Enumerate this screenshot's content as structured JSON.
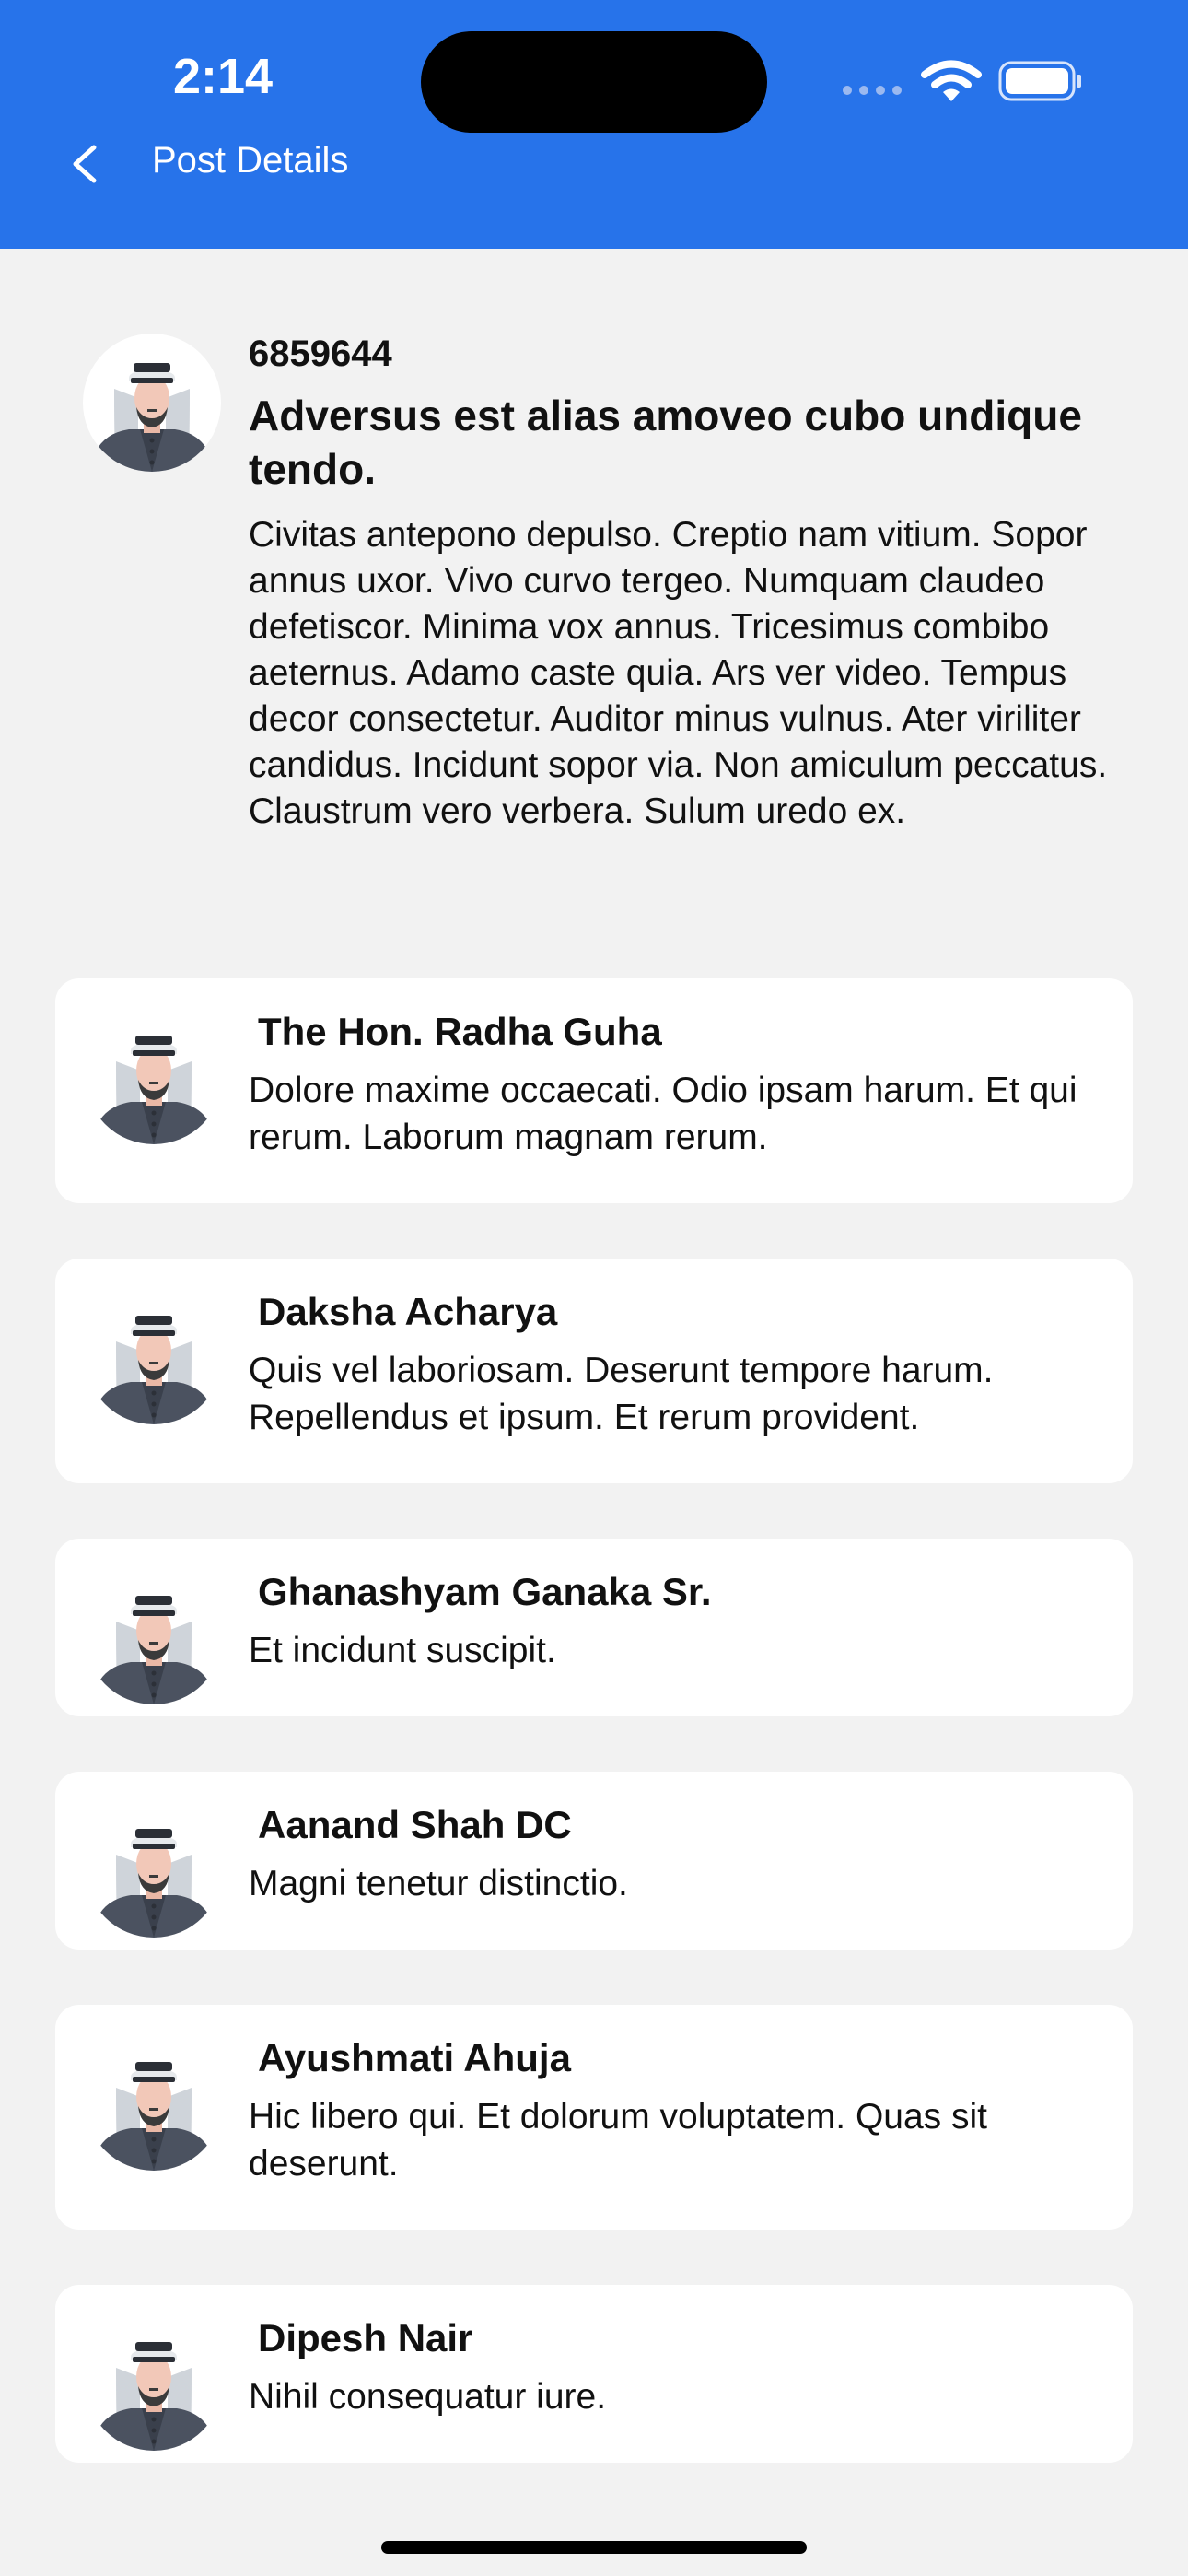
{
  "status_bar": {
    "time": "2:14"
  },
  "nav": {
    "title": "Post Details"
  },
  "colors": {
    "header": "#2773ea",
    "background": "#f2f2f2",
    "card": "#ffffff"
  },
  "post": {
    "id": "6859644",
    "title": "Adversus est alias amoveo cubo undique tendo.",
    "body": "Civitas antepono depulso. Creptio nam vitium. Sopor annus uxor. Vivo curvo tergeo. Numquam claudeo defetiscor. Minima vox annus. Tricesimus combibo aeternus. Adamo caste quia. Ars ver video. Tempus decor consectetur. Auditor minus vulnus. Ater viriliter candidus. Incidunt sopor via. Non amiculum peccatus. Claustrum vero verbera. Sulum uredo ex."
  },
  "comments": [
    {
      "name": "The Hon. Radha Guha",
      "text": "Dolore maxime occaecati. Odio ipsam harum. Et qui rerum. Laborum magnam rerum."
    },
    {
      "name": "Daksha Acharya",
      "text": "Quis vel laboriosam. Deserunt tempore harum. Repellendus et ipsum. Et rerum provident."
    },
    {
      "name": "Ghanashyam Ganaka Sr.",
      "text": "Et incidunt suscipit."
    },
    {
      "name": "Aanand Shah DC",
      "text": "Magni tenetur distinctio."
    },
    {
      "name": "Ayushmati Ahuja",
      "text": "Hic libero qui. Et dolorum voluptatem. Quas sit deserunt."
    },
    {
      "name": "Dipesh Nair",
      "text": "Nihil consequatur iure."
    }
  ]
}
